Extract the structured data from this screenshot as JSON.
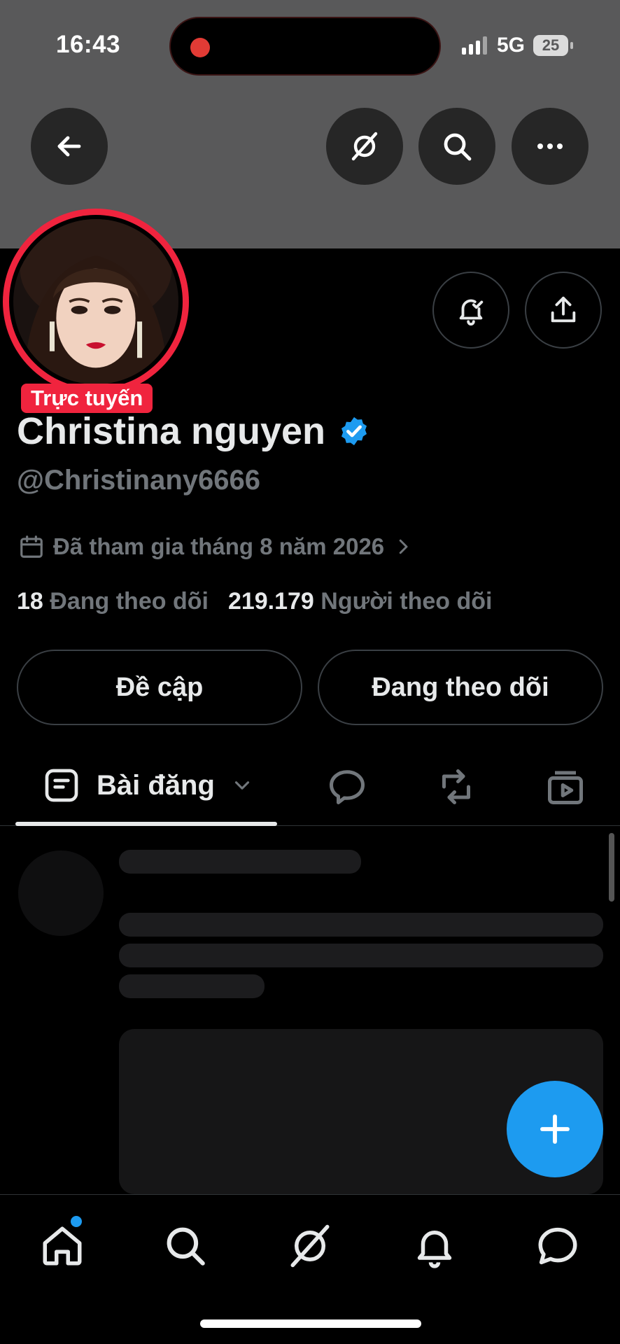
{
  "status_bar": {
    "time": "16:43",
    "network": "5G",
    "battery": "25"
  },
  "header": {
    "back_icon": "arrow-left-icon",
    "actions": [
      "grok-icon",
      "search-icon",
      "more-icon"
    ]
  },
  "profile": {
    "live_badge": "Trực tuyến",
    "display_name": "Christina nguyen",
    "handle": "@Christinany6666",
    "joined": "Đã tham gia tháng 8 năm 2026",
    "following_count": "18",
    "following_label": "Đang theo dõi",
    "followers_count": "219.179",
    "followers_label": "Người theo dõi",
    "colors": {
      "live_red": "#f0243e",
      "verified_blue": "#1d9bf0"
    }
  },
  "buttons": {
    "mention": "Đề cập",
    "following": "Đang theo dõi"
  },
  "tabs": {
    "active_label": "Bài đăng",
    "icons": [
      "posts-icon",
      "replies-icon",
      "reposts-icon",
      "media-icon"
    ]
  },
  "bottom_nav": [
    "home-icon",
    "search-icon",
    "grok-icon",
    "notifications-icon",
    "messages-icon"
  ]
}
